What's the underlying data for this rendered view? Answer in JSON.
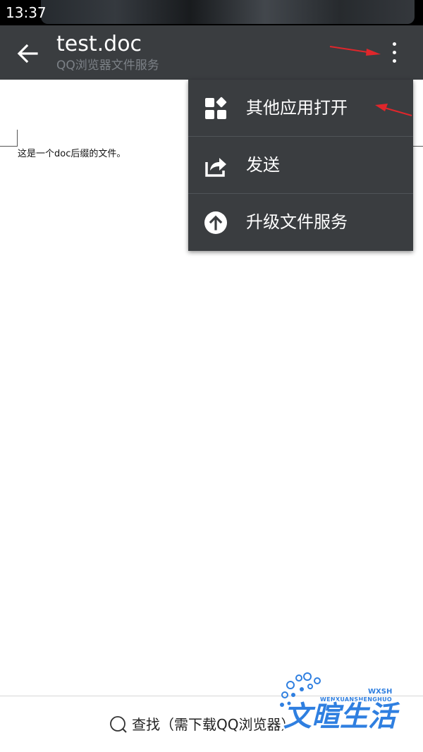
{
  "status_bar": {
    "time": "13:37"
  },
  "app_bar": {
    "title": "test.doc",
    "subtitle": "QQ浏览器文件服务",
    "back_icon": "arrow-left-icon",
    "more_icon": "more-vertical-icon"
  },
  "document": {
    "text": "这是一个doc后缀的文件。"
  },
  "menu": {
    "items": [
      {
        "label": "其他应用打开",
        "icon": "apps-grid-icon"
      },
      {
        "label": "发送",
        "icon": "share-icon"
      },
      {
        "label": "升级文件服务",
        "icon": "upgrade-arrow-icon"
      }
    ]
  },
  "bottom": {
    "find_text": "查找（需下载QQ浏览器）",
    "find_icon": "search-icon"
  },
  "watermark": {
    "title": "文暄生活",
    "subtitle": "WENXUANSHENGHUO",
    "abbr": "WXSH"
  },
  "colors": {
    "app_bar_bg": "#3a3d40",
    "menu_bg": "#3a3d40",
    "annotation_arrow": "#e0262b",
    "watermark": "#2f7fe0"
  }
}
